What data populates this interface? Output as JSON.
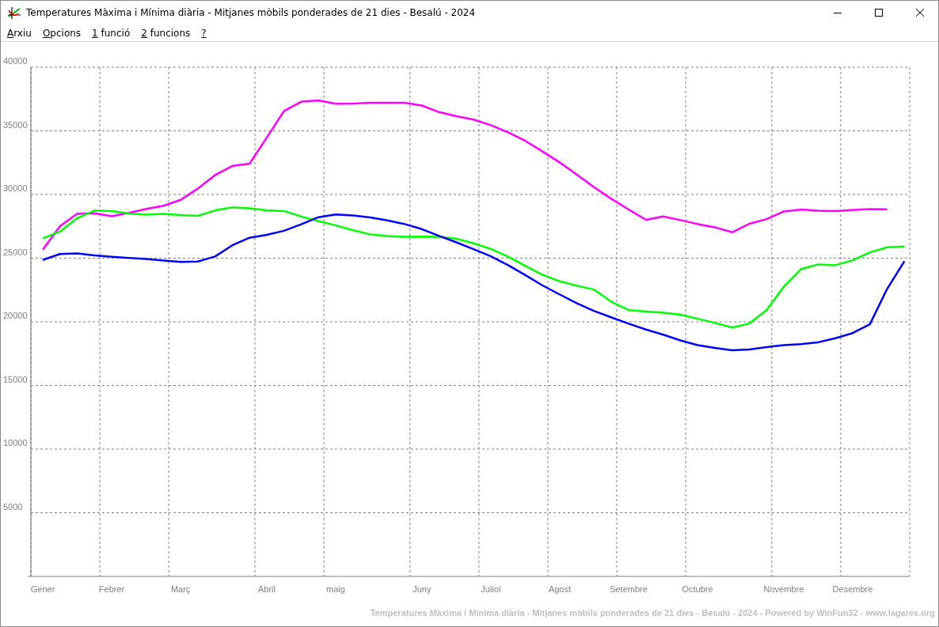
{
  "window": {
    "title": "Temperatures Màxima i Mínima diària - Mitjanes mòbils ponderades de 21 dies - Besalú - 2024"
  },
  "menu": [
    "Arxiu",
    "Opcions",
    "1 funció",
    "2 funcions",
    "?"
  ],
  "chart": {
    "chart_data": {
      "type": "line",
      "ylim": [
        0,
        40000
      ],
      "grid": true,
      "yticks": [
        5000,
        10000,
        15000,
        20000,
        25000,
        30000,
        35000,
        40000
      ],
      "categories": [
        "Gener",
        null,
        null,
        null,
        "Febrer",
        null,
        null,
        null,
        "Març",
        null,
        null,
        null,
        null,
        "Abril",
        null,
        null,
        null,
        "maig",
        null,
        null,
        null,
        null,
        "Juny",
        null,
        null,
        null,
        "Juliol",
        null,
        null,
        null,
        "Agost",
        null,
        null,
        null,
        "Setembre",
        null,
        null,
        null,
        "Octubre",
        null,
        null,
        null,
        null,
        "Novembre",
        null,
        null,
        null,
        "Desembre",
        null,
        null,
        null
      ],
      "series": [
        {
          "color": "#ff00ff",
          "values": [
            25670,
            27510,
            28490,
            28530,
            28300,
            28550,
            28870,
            29110,
            29580,
            30470,
            31530,
            32250,
            32420,
            34480,
            36560,
            37290,
            37390,
            37130,
            37140,
            37200,
            37200,
            37200,
            36990,
            36470,
            36150,
            35880,
            35440,
            34890,
            34210,
            33380,
            32510,
            31550,
            30560,
            29650,
            28820,
            28010,
            28280,
            27990,
            27680,
            27430,
            27030,
            27700,
            28070,
            28670,
            28820,
            28720,
            28700,
            28780,
            28860,
            28840,
            null
          ]
        },
        {
          "color": "#00ff00",
          "values": [
            26560,
            27090,
            28150,
            28740,
            28690,
            28510,
            28410,
            28470,
            28380,
            28320,
            28750,
            28990,
            28920,
            28760,
            28700,
            28270,
            27900,
            27570,
            27190,
            26870,
            26730,
            26670,
            26690,
            26670,
            26520,
            26160,
            25720,
            25120,
            24390,
            23690,
            23180,
            22830,
            22520,
            21560,
            20920,
            20810,
            20720,
            20560,
            20240,
            19910,
            19550,
            19870,
            20920,
            22760,
            24140,
            24510,
            24450,
            24840,
            25460,
            25860,
            25920
          ]
        },
        {
          "color": "#0000ff",
          "values": [
            24860,
            25320,
            25380,
            25220,
            25110,
            25010,
            24930,
            24820,
            24700,
            24740,
            25130,
            26010,
            26600,
            26830,
            27150,
            27660,
            28220,
            28430,
            28360,
            28200,
            27970,
            27680,
            27280,
            26750,
            26240,
            25700,
            25140,
            24450,
            23670,
            22860,
            22140,
            21450,
            20850,
            20340,
            19850,
            19390,
            18990,
            18540,
            18170,
            17950,
            17760,
            17830,
            18010,
            18160,
            18240,
            18390,
            18710,
            19120,
            19810,
            22590,
            24760
          ]
        }
      ]
    },
    "footer": "Temperatures Màxima i Mínima diària - Mitjanes mòbils ponderades de 21 dies - Besalú - 2024 - Powered by WinFun32 - www.lagares.org"
  }
}
